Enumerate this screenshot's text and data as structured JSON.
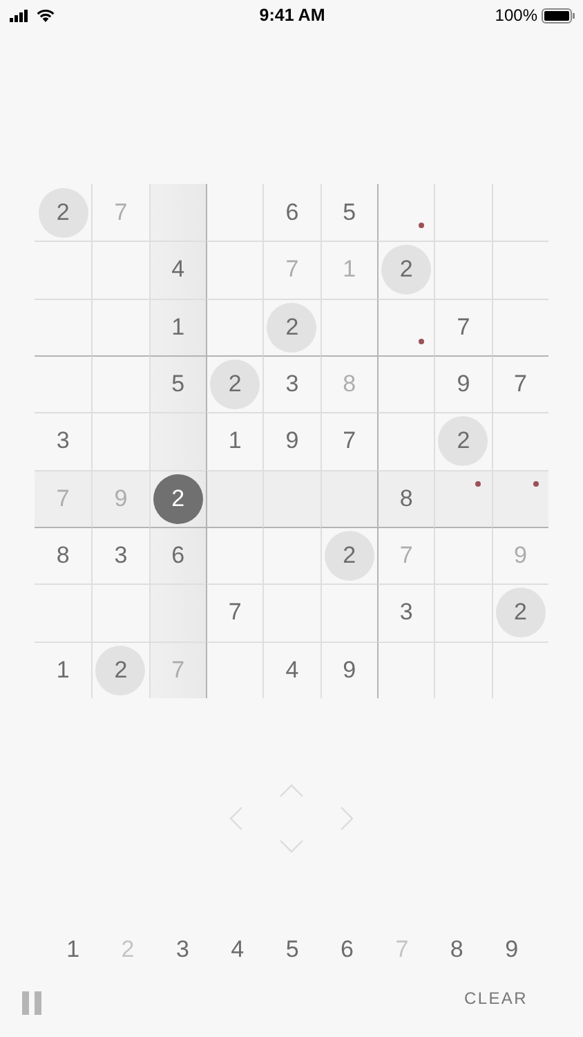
{
  "status_bar": {
    "time": "9:41 AM",
    "battery": "100%"
  },
  "grid": [
    [
      {
        "value": "2",
        "faded": false,
        "match": true,
        "selected": false
      },
      {
        "value": "7",
        "faded": true,
        "match": false,
        "selected": false
      },
      {
        "selected": false
      },
      {
        "selected": false
      },
      {
        "value": "6",
        "faded": false,
        "match": false,
        "selected": false
      },
      {
        "value": "5",
        "faded": false,
        "match": false,
        "selected": false
      },
      {
        "note": true,
        "note_top": false,
        "selected": false
      },
      {
        "selected": false
      },
      {
        "selected": false
      }
    ],
    [
      {
        "selected": false
      },
      {
        "selected": false
      },
      {
        "value": "4",
        "faded": false,
        "match": false,
        "selected": false
      },
      {
        "selected": false
      },
      {
        "value": "7",
        "faded": true,
        "match": false,
        "selected": false
      },
      {
        "value": "1",
        "faded": true,
        "match": false,
        "selected": false
      },
      {
        "value": "2",
        "faded": false,
        "match": true,
        "selected": false
      },
      {
        "selected": false
      },
      {
        "selected": false
      }
    ],
    [
      {
        "selected": false
      },
      {
        "selected": false
      },
      {
        "value": "1",
        "faded": false,
        "match": false,
        "selected": false
      },
      {
        "selected": false
      },
      {
        "value": "2",
        "faded": false,
        "match": true,
        "selected": false
      },
      {
        "selected": false
      },
      {
        "note": true,
        "note_top": false,
        "selected": false
      },
      {
        "value": "7",
        "faded": false,
        "match": false,
        "selected": false
      },
      {
        "selected": false
      }
    ],
    [
      {
        "selected": false
      },
      {
        "selected": false
      },
      {
        "value": "5",
        "faded": false,
        "match": false,
        "selected": false
      },
      {
        "value": "2",
        "faded": false,
        "match": true,
        "selected": false
      },
      {
        "value": "3",
        "faded": false,
        "match": false,
        "selected": false
      },
      {
        "value": "8",
        "faded": true,
        "match": false,
        "selected": false
      },
      {
        "selected": false
      },
      {
        "value": "9",
        "faded": false,
        "match": false,
        "selected": false
      },
      {
        "value": "7",
        "faded": false,
        "match": false,
        "selected": false
      }
    ],
    [
      {
        "value": "3",
        "faded": false,
        "match": false,
        "selected": false
      },
      {
        "selected": false
      },
      {
        "selected": false
      },
      {
        "value": "1",
        "faded": false,
        "match": false,
        "selected": false
      },
      {
        "value": "9",
        "faded": false,
        "match": false,
        "selected": false
      },
      {
        "value": "7",
        "faded": false,
        "match": false,
        "selected": false
      },
      {
        "selected": false
      },
      {
        "value": "2",
        "faded": false,
        "match": true,
        "selected": false
      },
      {
        "selected": false
      }
    ],
    [
      {
        "value": "7",
        "faded": true,
        "match": false,
        "selected": false
      },
      {
        "value": "9",
        "faded": true,
        "match": false,
        "selected": false
      },
      {
        "value": "2",
        "faded": false,
        "match": true,
        "selected": true
      },
      {
        "selected": false
      },
      {
        "selected": false
      },
      {
        "selected": false
      },
      {
        "value": "8",
        "faded": false,
        "match": false,
        "selected": false
      },
      {
        "note": true,
        "note_top": true,
        "selected": false
      },
      {
        "note": true,
        "note_top": true,
        "selected": false
      }
    ],
    [
      {
        "value": "8",
        "faded": false,
        "match": false,
        "selected": false
      },
      {
        "value": "3",
        "faded": false,
        "match": false,
        "selected": false
      },
      {
        "value": "6",
        "faded": false,
        "match": false,
        "selected": false
      },
      {
        "selected": false
      },
      {
        "selected": false
      },
      {
        "value": "2",
        "faded": false,
        "match": true,
        "selected": false
      },
      {
        "value": "7",
        "faded": true,
        "match": false,
        "selected": false
      },
      {
        "selected": false
      },
      {
        "value": "9",
        "faded": true,
        "match": false,
        "selected": false
      }
    ],
    [
      {
        "selected": false
      },
      {
        "selected": false
      },
      {
        "selected": false
      },
      {
        "value": "7",
        "faded": false,
        "match": false,
        "selected": false
      },
      {
        "selected": false
      },
      {
        "selected": false
      },
      {
        "value": "3",
        "faded": false,
        "match": false,
        "selected": false
      },
      {
        "selected": false
      },
      {
        "value": "2",
        "faded": false,
        "match": true,
        "selected": false
      }
    ],
    [
      {
        "value": "1",
        "faded": false,
        "match": false,
        "selected": false
      },
      {
        "value": "2",
        "faded": false,
        "match": true,
        "selected": false
      },
      {
        "value": "7",
        "faded": true,
        "match": false,
        "selected": false
      },
      {
        "selected": false
      },
      {
        "value": "4",
        "faded": false,
        "match": false,
        "selected": false
      },
      {
        "value": "9",
        "faded": false,
        "match": false,
        "selected": false
      },
      {
        "selected": false
      },
      {
        "selected": false
      },
      {
        "selected": false
      }
    ]
  ],
  "number_pad": [
    {
      "label": "1",
      "complete": false
    },
    {
      "label": "2",
      "complete": true
    },
    {
      "label": "3",
      "complete": false
    },
    {
      "label": "4",
      "complete": false
    },
    {
      "label": "5",
      "complete": false
    },
    {
      "label": "6",
      "complete": false
    },
    {
      "label": "7",
      "complete": true
    },
    {
      "label": "8",
      "complete": false
    },
    {
      "label": "9",
      "complete": false
    }
  ],
  "clear_button": "CLEAR"
}
